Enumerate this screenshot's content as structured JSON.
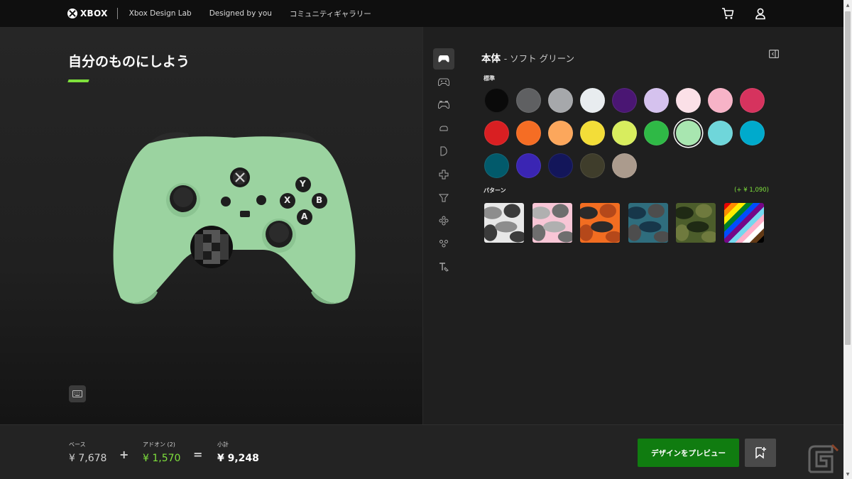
{
  "nav": {
    "brand": "XBOX",
    "links": [
      "Xbox Design Lab",
      "Designed by you",
      "コミュニティギャラリー"
    ]
  },
  "hero": {
    "title": "自分のものにしよう",
    "accent_color": "#7ee03c",
    "controller_color": "#9bd3a0"
  },
  "panel": {
    "title": "本体",
    "subtitle": "- ソフト グリーン",
    "standard_label": "標準",
    "pattern_label": "パターン",
    "pattern_price": "(+ ¥ 1,090)",
    "swatches": [
      {
        "name": "black",
        "color": "#0a0a0a"
      },
      {
        "name": "storm-grey",
        "color": "#5f6062"
      },
      {
        "name": "silver",
        "color": "#a6a8ab"
      },
      {
        "name": "white",
        "color": "#e8ecef"
      },
      {
        "name": "purple",
        "color": "#4a1673"
      },
      {
        "name": "lavender",
        "color": "#d5c2ee"
      },
      {
        "name": "light-pink",
        "color": "#fbe0e7"
      },
      {
        "name": "pink",
        "color": "#f7b3c7"
      },
      {
        "name": "raspberry",
        "color": "#d6335e"
      },
      {
        "name": "red",
        "color": "#d91f22"
      },
      {
        "name": "orange",
        "color": "#f56d24"
      },
      {
        "name": "peach",
        "color": "#fca75c"
      },
      {
        "name": "yellow",
        "color": "#f3dd38"
      },
      {
        "name": "lime",
        "color": "#d8ed5e"
      },
      {
        "name": "green",
        "color": "#2fb946"
      },
      {
        "name": "soft-green",
        "color": "#a8e6b0",
        "selected": true
      },
      {
        "name": "aqua",
        "color": "#6fd6da"
      },
      {
        "name": "cyan",
        "color": "#00aacc"
      },
      {
        "name": "teal",
        "color": "#025a6b"
      },
      {
        "name": "indigo",
        "color": "#3a25b3"
      },
      {
        "name": "navy",
        "color": "#13165a"
      },
      {
        "name": "olive",
        "color": "#3f3d2b"
      },
      {
        "name": "taupe",
        "color": "#ab9b8d"
      }
    ],
    "patterns": [
      {
        "name": "arctic-camo",
        "colors": [
          "#e8e8e8",
          "#8d8d8d",
          "#3b3b3b"
        ]
      },
      {
        "name": "pink-camo",
        "colors": [
          "#f8c6d6",
          "#b0b0b0",
          "#6e6e6e"
        ]
      },
      {
        "name": "orange-camo",
        "colors": [
          "#f26d21",
          "#2a2a2a",
          "#b5481a"
        ]
      },
      {
        "name": "blue-camo",
        "colors": [
          "#2f6d7d",
          "#17374a",
          "#4d4d4d"
        ]
      },
      {
        "name": "forest-camo",
        "colors": [
          "#4c5d2b",
          "#1f2a14",
          "#6f7a3e"
        ]
      },
      {
        "name": "pride",
        "colors": [
          "#e40303",
          "#ff8c00",
          "#ffed00",
          "#008026",
          "#004dff",
          "#750787",
          "#74d7ee",
          "#ffafc8",
          "#ffffff",
          "#613915",
          "#000000"
        ]
      }
    ]
  },
  "pricing": {
    "base_label": "ベース",
    "base_value": "¥ 7,678",
    "addon_label": "アドオン (2)",
    "addon_value": "¥ 1,570",
    "subtotal_label": "小計",
    "subtotal_value": "¥ 9,248",
    "plus": "+",
    "equals": "=",
    "addon_color": "#7ee03c"
  },
  "actions": {
    "preview_label": "デザインをプレビュー"
  },
  "controller": {
    "face_buttons": [
      "Y",
      "B",
      "X",
      "A"
    ]
  }
}
